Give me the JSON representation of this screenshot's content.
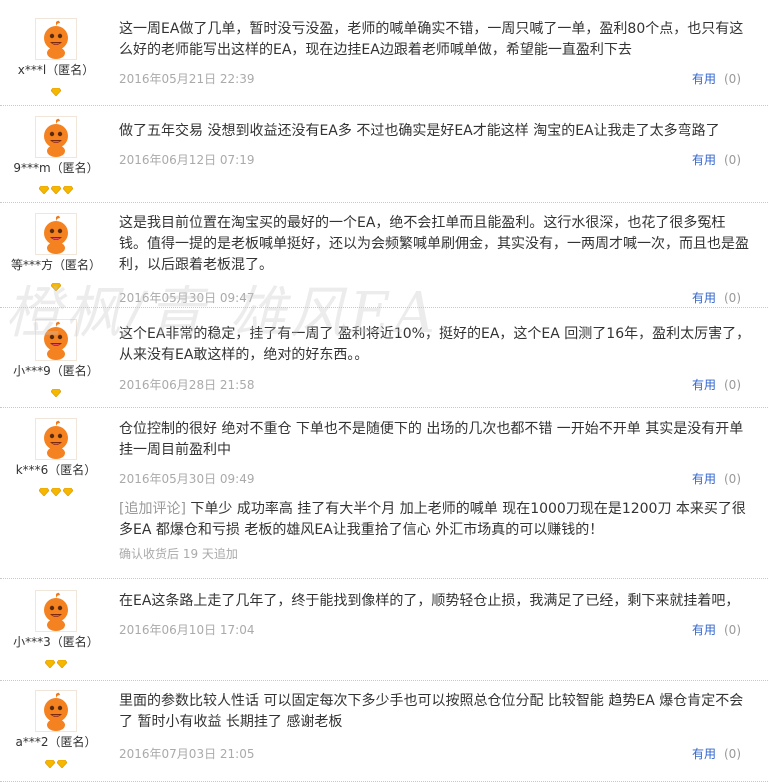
{
  "useful_label": "有用",
  "useful_count": "(0)",
  "watermark": "橙枫/青 雄风EA",
  "reviews": [
    {
      "user": "x***l（匿名）",
      "rank": 1,
      "text": "这一周EA做了几单，暂时没亏没盈，老师的喊单确实不错，一周只喊了一单，盈利80个点，也只有这么好的老师能写出这样的EA，现在边挂EA边跟着老师喊单做，希望能一直盈利下去",
      "date": "2016年05月21日 22:39"
    },
    {
      "user": "9***m（匿名）",
      "rank": 3,
      "text": "做了五年交易 没想到收益还没有EA多 不过也确实是好EA才能这样 淘宝的EA让我走了太多弯路了",
      "date": "2016年06月12日 07:19"
    },
    {
      "user": "等***方（匿名）",
      "rank": 1,
      "text": "这是我目前位置在淘宝买的最好的一个EA，绝不会扛单而且能盈利。这行水很深，也花了很多冤枉钱。值得一提的是老板喊单挺好，还以为会频繁喊单刷佣金，其实没有，一两周才喊一次，而且也是盈利，以后跟着老板混了。",
      "date": "2016年05月30日 09:47"
    },
    {
      "user": "小***9（匿名）",
      "rank": 1,
      "text": "这个EA非常的稳定，挂了有一周了 盈利将近10%，挺好的EA，这个EA 回测了16年，盈利太厉害了，从来没有EA敢这样的，绝对的好东西。。",
      "date": "2016年06月28日 21:58"
    },
    {
      "user": "k***6（匿名）",
      "rank": 3,
      "text": "仓位控制的很好 绝对不重仓 下单也不是随便下的 出场的几次也都不错 一开始不开单 其实是没有开单挂一周目前盈利中",
      "date": "2016年05月30日 09:49",
      "append_tag": "[追加评论]",
      "append_text": "下单少 成功率高 挂了有大半个月 加上老师的喊单 现在1000刀现在是1200刀 本来买了很多EA 都爆仓和亏损 老板的雄风EA让我重拾了信心 外汇市场真的可以赚钱的！",
      "confirm": "确认收货后 19 天追加"
    },
    {
      "user": "小***3（匿名）",
      "rank": 2,
      "text": "在EA这条路上走了几年了，终于能找到像样的了，顺势轻仓止损，我满足了已经，剩下来就挂着吧，",
      "date": "2016年06月10日 17:04"
    },
    {
      "user": "a***2（匿名）",
      "rank": 2,
      "text": "里面的参数比较人性话 可以固定每次下多少手也可以按照总仓位分配 比较智能 趋势EA 爆仓肯定不会了 暂时小有收益 长期挂了 感谢老板",
      "date": "2016年07月03日 21:05"
    }
  ]
}
